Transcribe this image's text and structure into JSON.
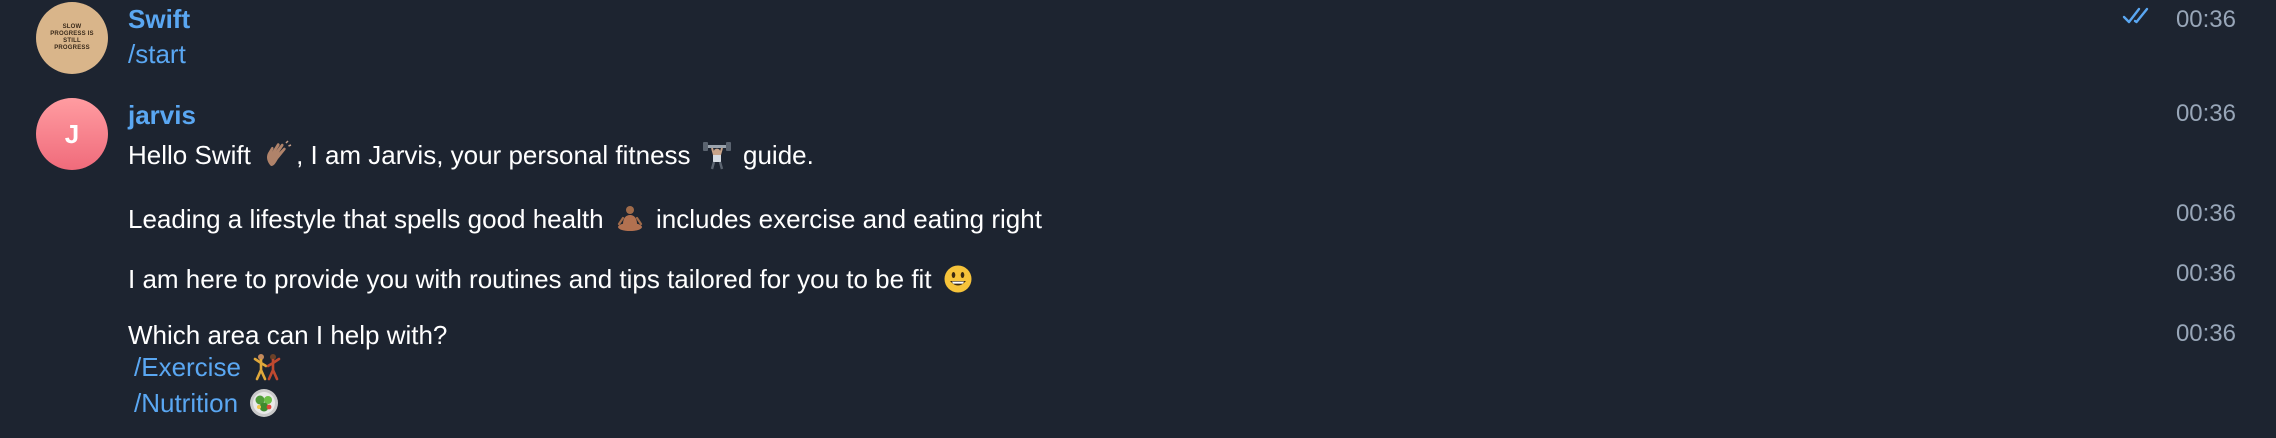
{
  "messages": [
    {
      "sender": "Swift",
      "avatar_text": "SLOW PROGRESS IS STILL PROGRESS",
      "text": "/start",
      "time": "00:36",
      "status_icon": "double-check-icon"
    },
    {
      "sender": "jarvis",
      "avatar_initial": "J",
      "lines": [
        {
          "part1": "Hello Swift",
          "emoji1": "waving-hand-emoji",
          "part2": ", I am Jarvis, your personal fitness",
          "emoji2": "weightlifter-emoji",
          "part3": "guide.",
          "time": "00:36"
        },
        {
          "part1": "Leading a lifestyle that spells good health",
          "emoji1": "meditation-emoji",
          "part2": "includes exercise and eating right",
          "time": "00:36"
        },
        {
          "part1": "I am here to provide you with routines and tips tailored for you to be fit",
          "emoji1": "smiling-face-emoji",
          "time": "00:36"
        },
        {
          "part1": "Which area can I help with?",
          "time": "00:36",
          "options": [
            {
              "label": "/Exercise",
              "emoji": "exercise-emoji"
            },
            {
              "label": "/Nutrition",
              "emoji": "salad-emoji"
            }
          ]
        }
      ]
    }
  ]
}
